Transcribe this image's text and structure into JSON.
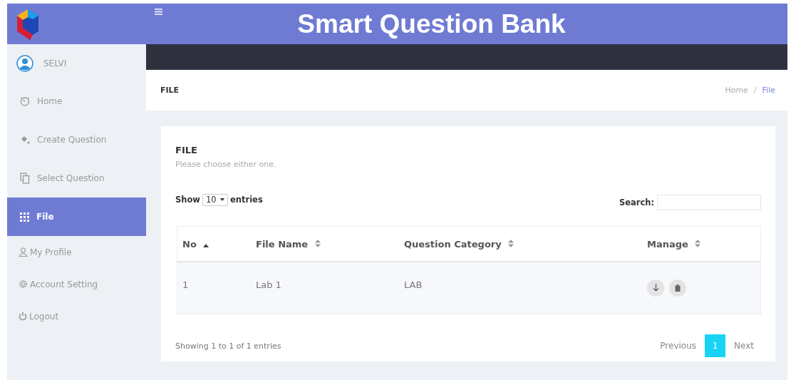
{
  "header": {
    "title": "Smart Question Bank"
  },
  "sidebar": {
    "user": "SELVI",
    "items": [
      {
        "label": "Home",
        "selected": false
      },
      {
        "label": "Create Question",
        "selected": false
      },
      {
        "label": "Select Question",
        "selected": false
      },
      {
        "label": "File",
        "selected": true
      },
      {
        "label": "My Profile",
        "selected": false
      },
      {
        "label": "Account Setting",
        "selected": false
      },
      {
        "label": "Logout",
        "selected": false
      }
    ]
  },
  "page_header": {
    "title": "FILE",
    "breadcrumb": [
      {
        "label": "Home",
        "selected": false
      },
      {
        "label": "File",
        "selected": true
      }
    ],
    "separator": "/"
  },
  "card": {
    "title": "FILE",
    "subtitle": "Please choose either one.",
    "length": {
      "before": "Show",
      "value": "10",
      "after": "entries"
    },
    "search_label": "Search:",
    "table": {
      "columns": [
        {
          "label": "No",
          "sorted": true
        },
        {
          "label": "File Name",
          "sorted": false
        },
        {
          "label": "Question Category",
          "sorted": false
        },
        {
          "label": "Manage",
          "sorted": false
        }
      ],
      "rows": [
        {
          "no": "1",
          "file_name": "Lab 1",
          "category": "LAB"
        }
      ]
    },
    "info": "Showing 1 to 1 of 1 entries",
    "pagination": [
      {
        "label": "Previous",
        "kind": "nav",
        "selected": false
      },
      {
        "label": "1",
        "kind": "page",
        "selected": true
      },
      {
        "label": "Next",
        "kind": "nav",
        "selected": false
      }
    ]
  }
}
